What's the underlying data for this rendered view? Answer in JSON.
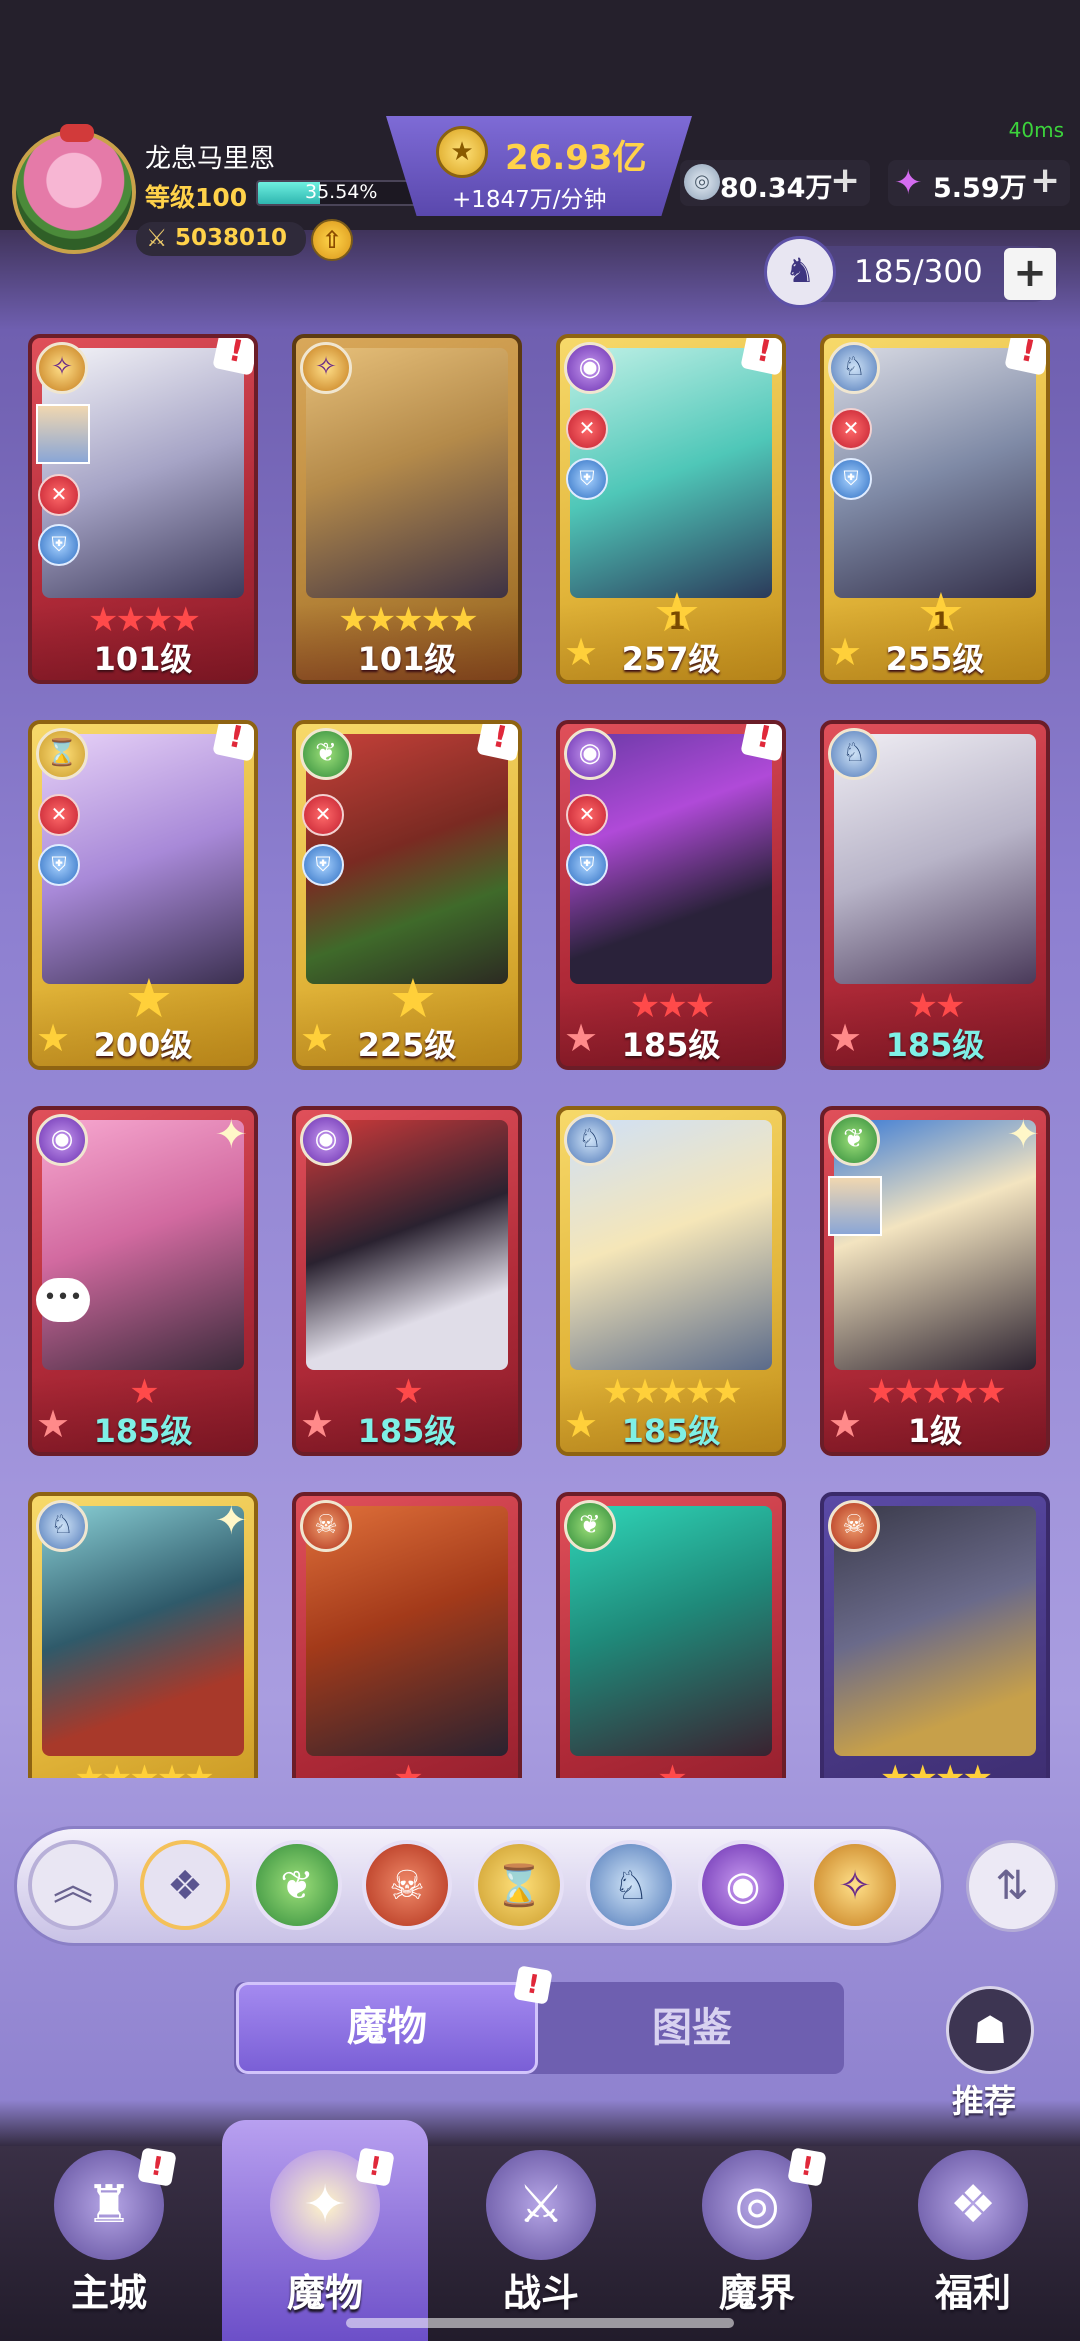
{
  "header": {
    "ping": "40ms",
    "player_name": "龙息马里恩",
    "level_label": "等级100",
    "exp_percent_text": "35.54%",
    "exp_fraction": 0.3554,
    "power": "5038010",
    "gold_amount": "26.93亿",
    "gold_rate": "+1847万/分钟",
    "currency1": "80.34万",
    "currency2": "5.59万",
    "plus": "+"
  },
  "capacity": {
    "text": "185/300",
    "plus": "+"
  },
  "cards": [
    {
      "level": "101级",
      "stars": "★★★★",
      "faction": "void"
    },
    {
      "level": "101级",
      "stars": "★★★★★",
      "faction": "void"
    },
    {
      "level": "257级",
      "bigstar": "1",
      "faction": "eye"
    },
    {
      "level": "255级",
      "bigstar": "1",
      "faction": "dragon"
    },
    {
      "level": "200级",
      "bigstar": "",
      "faction": "time"
    },
    {
      "level": "225级",
      "bigstar": "",
      "faction": "leaf"
    },
    {
      "level": "185级",
      "stars": "★★★",
      "faction": "eye"
    },
    {
      "level": "185级",
      "stars": "★★",
      "faction": "dragon"
    },
    {
      "level": "185级",
      "stars": "★",
      "faction": "eye"
    },
    {
      "level": "185级",
      "stars": "★",
      "faction": "eye"
    },
    {
      "level": "185级",
      "stars": "★★★★★",
      "faction": "dragon"
    },
    {
      "level": "1级",
      "stars": "★★★★★",
      "faction": "leaf"
    },
    {
      "stars": "★★★★★",
      "faction": "dragon"
    },
    {
      "stars": "★",
      "faction": "skull"
    },
    {
      "stars": "★",
      "faction": "leaf"
    },
    {
      "stars": "★★★★",
      "faction": "skull"
    }
  ],
  "filters": [
    "up-icon",
    "all-icon",
    "leaf-icon",
    "skull-icon",
    "hourglass-icon",
    "dragon-icon",
    "eye-icon",
    "void-icon"
  ],
  "tabs": {
    "active": "魔物",
    "inactive": "图鉴"
  },
  "recommend_label": "推荐",
  "nav": [
    "主城",
    "魔物",
    "战斗",
    "魔界",
    "福利"
  ],
  "colors": {
    "accent": "#7a5fd6",
    "gold": "#ffd24a",
    "alert": "#e0283a"
  }
}
